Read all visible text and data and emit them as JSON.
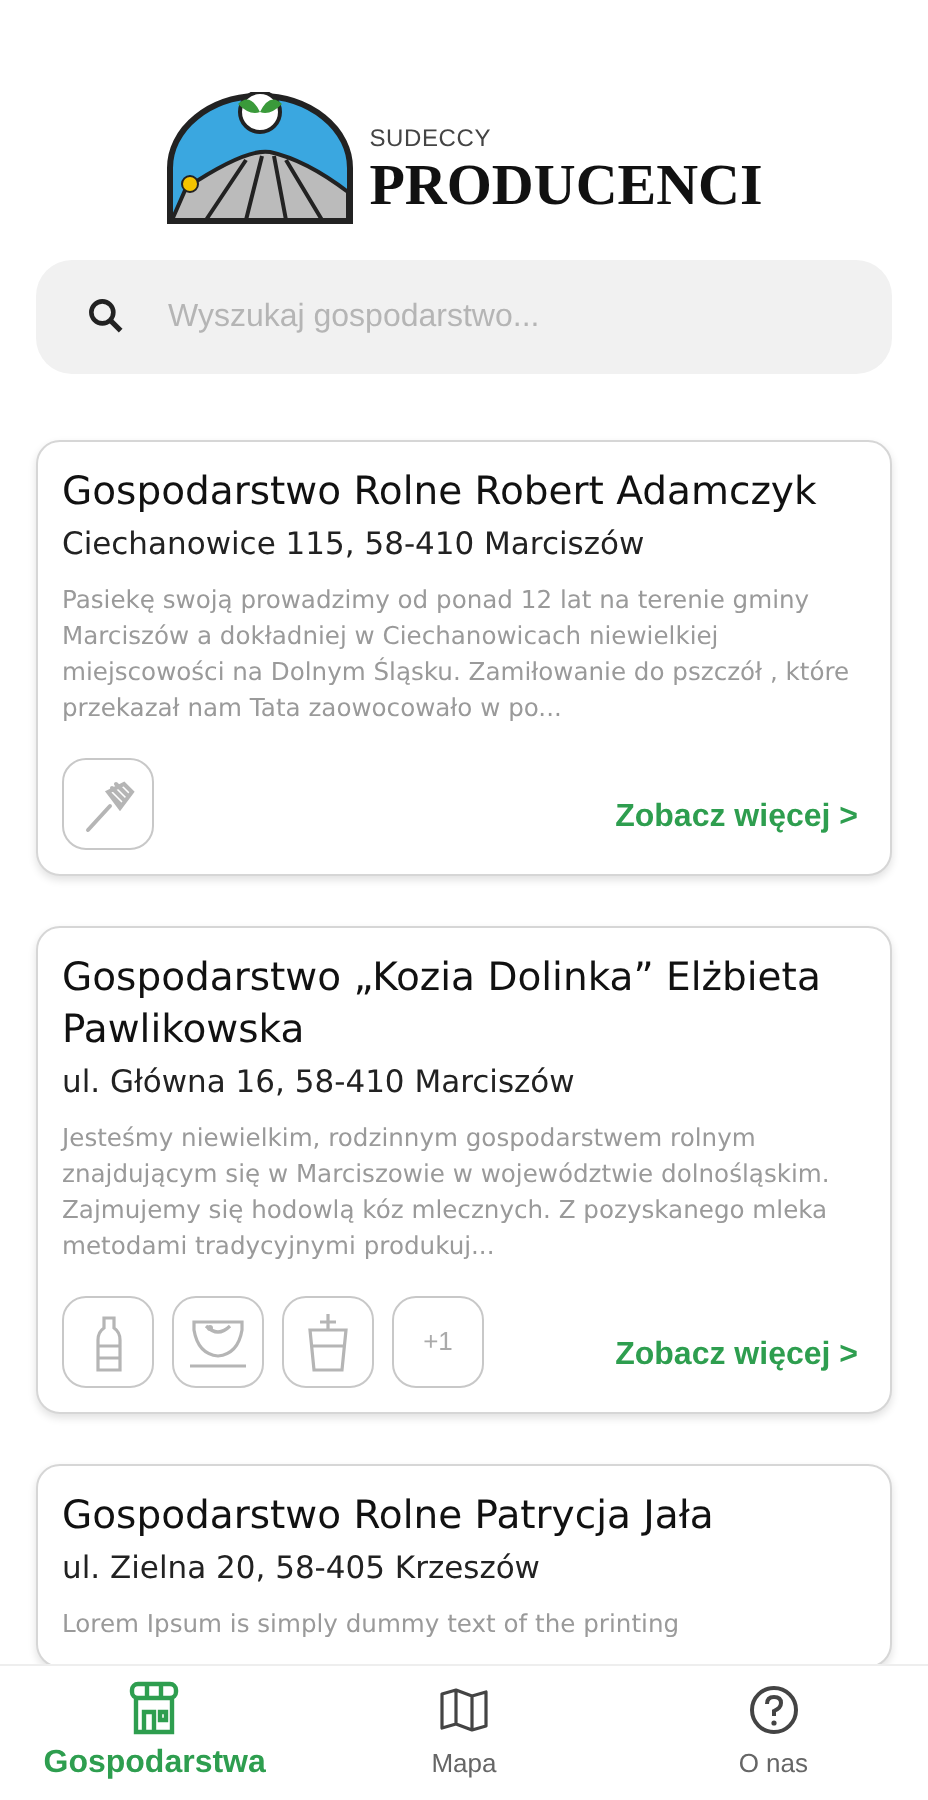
{
  "logo": {
    "small": "SUDECCY",
    "large": "PRODUCENCI"
  },
  "search": {
    "placeholder": "Wyszukaj gospodarstwo..."
  },
  "farms": [
    {
      "name": "Gospodarstwo Rolne Robert Adamczyk",
      "address": "Ciechanowice 115, 58-410 Marciszów",
      "description": "Pasiekę swoją prowadzimy od ponad 12 lat na terenie gminy Marciszów a dokładniej w Ciechanowicach niewielkiej miejscowości na Dolnym Śląsku. Zamiłowanie do pszczół , które przekazał nam Tata zaowocowało w po...",
      "products": [
        {
          "kind": "dipper"
        }
      ],
      "link": "Zobacz więcej >"
    },
    {
      "name": "Gospodarstwo „Kozia Dolinka” Elżbieta Pawlikowska",
      "address": "ul. Główna 16, 58-410 Marciszów",
      "description": "Jesteśmy niewielkim, rodzinnym gospodarstwem rolnym znajdującym się w Marciszowie w województwie dolnośląskim. Zajmujemy się hodowlą kóz mlecznych. Z pozyskanego mleka metodami tradycyjnymi produkuj...",
      "products": [
        {
          "kind": "bottle"
        },
        {
          "kind": "bowl"
        },
        {
          "kind": "jar"
        },
        {
          "kind": "more",
          "label": "+1"
        }
      ],
      "link": "Zobacz więcej >"
    },
    {
      "name": "Gospodarstwo Rolne Patrycja Jała",
      "address": "ul. Zielna 20, 58-405 Krzeszów",
      "description": "Lorem Ipsum is simply dummy text of the printing"
    }
  ],
  "nav": [
    {
      "label": "Gospodarstwa",
      "selected": true
    },
    {
      "label": "Mapa",
      "selected": false
    },
    {
      "label": "O nas",
      "selected": false
    }
  ]
}
